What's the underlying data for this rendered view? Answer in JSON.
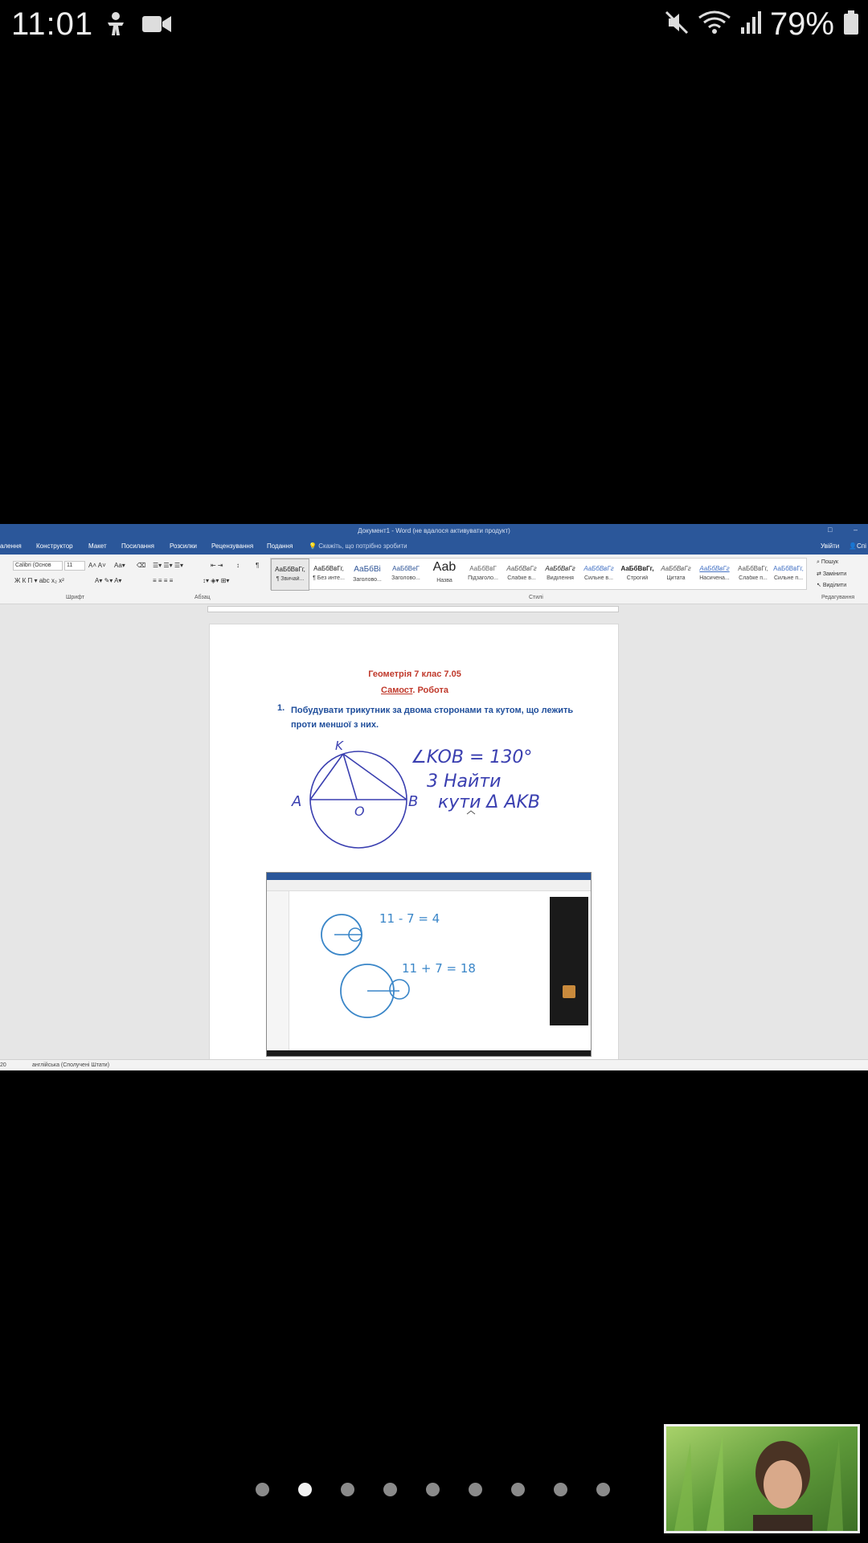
{
  "status_bar": {
    "time": "11:01",
    "battery_percent": "79%",
    "icons_left": [
      "accessibility-icon",
      "video-camera-icon"
    ],
    "icons_right": [
      "mute-icon",
      "wifi-icon",
      "signal-icon",
      "battery-icon"
    ]
  },
  "word": {
    "window_title": "Документ1 - Word (не вдалося активувати продукт)",
    "menu": [
      "алення",
      "Конструктор",
      "Макет",
      "Посилання",
      "Розсилки",
      "Рецензування",
      "Подання"
    ],
    "tell_me": "Скажіть, що потрібно зробити",
    "sign_in": "Увійти",
    "share": "Спі",
    "font_name": "Calibri (Основ",
    "font_size": "11",
    "group_labels": {
      "font": "Шрифт",
      "paragraph": "Абзац",
      "styles": "Стилі",
      "editing": "Редагування"
    },
    "styles": [
      {
        "sample": "АаБбВвГг,",
        "name": "¶ Звичай..."
      },
      {
        "sample": "АаБбВвГг,",
        "name": "¶ Без инте..."
      },
      {
        "sample": "АаБбВі",
        "name": "Заголово..."
      },
      {
        "sample": "АаБбВеГ",
        "name": "Заголово..."
      },
      {
        "sample": "Ааb",
        "name": "Назва"
      },
      {
        "sample": "АаБбВвГ",
        "name": "Підзаголо..."
      },
      {
        "sample": "АаБбВвГг",
        "name": "Слабке в..."
      },
      {
        "sample": "АаБбВвГг",
        "name": "Виділення"
      },
      {
        "sample": "АаБбВвГг",
        "name": "Сильне в..."
      },
      {
        "sample": "АаБбВвГг,",
        "name": "Строгий"
      },
      {
        "sample": "АаБбВвГг",
        "name": "Цитата"
      },
      {
        "sample": "АаБбВвГг",
        "name": "Насичена..."
      },
      {
        "sample": "АаБбВвГг,",
        "name": "Слабке п..."
      },
      {
        "sample": "АаБбВвГг,",
        "name": "Сильне п..."
      }
    ],
    "editing": [
      "Пошук",
      "Замінити",
      "Виділити"
    ],
    "document": {
      "title": "Геометрія 7 клас   7.05",
      "subtitle_underlined": "Самост",
      "subtitle_rest": ". Робота",
      "task_number": "1.",
      "task_text": "Побудувати трикутник за двома сторонами та кутом, що лежить проти меншої з них."
    },
    "handwriting": {
      "angle": "∠KOB = 130°",
      "task_line1": "3 Найти",
      "task_line2": "кути Δ AKB",
      "label_k": "K",
      "label_a": "A",
      "label_o": "O",
      "label_b": "B",
      "eq1": "11 - 7 = 4",
      "eq2": "11 + 7 = 18"
    },
    "status_language": "англійська (Сполучені Штати)",
    "status_page": "20"
  },
  "pagination": {
    "count": 9,
    "active_index": 1
  },
  "colors": {
    "word_blue": "#2b579a",
    "doc_title_red": "#c0392b",
    "doc_text_blue": "#1f4e9b",
    "ink": "#3a3fb0"
  }
}
